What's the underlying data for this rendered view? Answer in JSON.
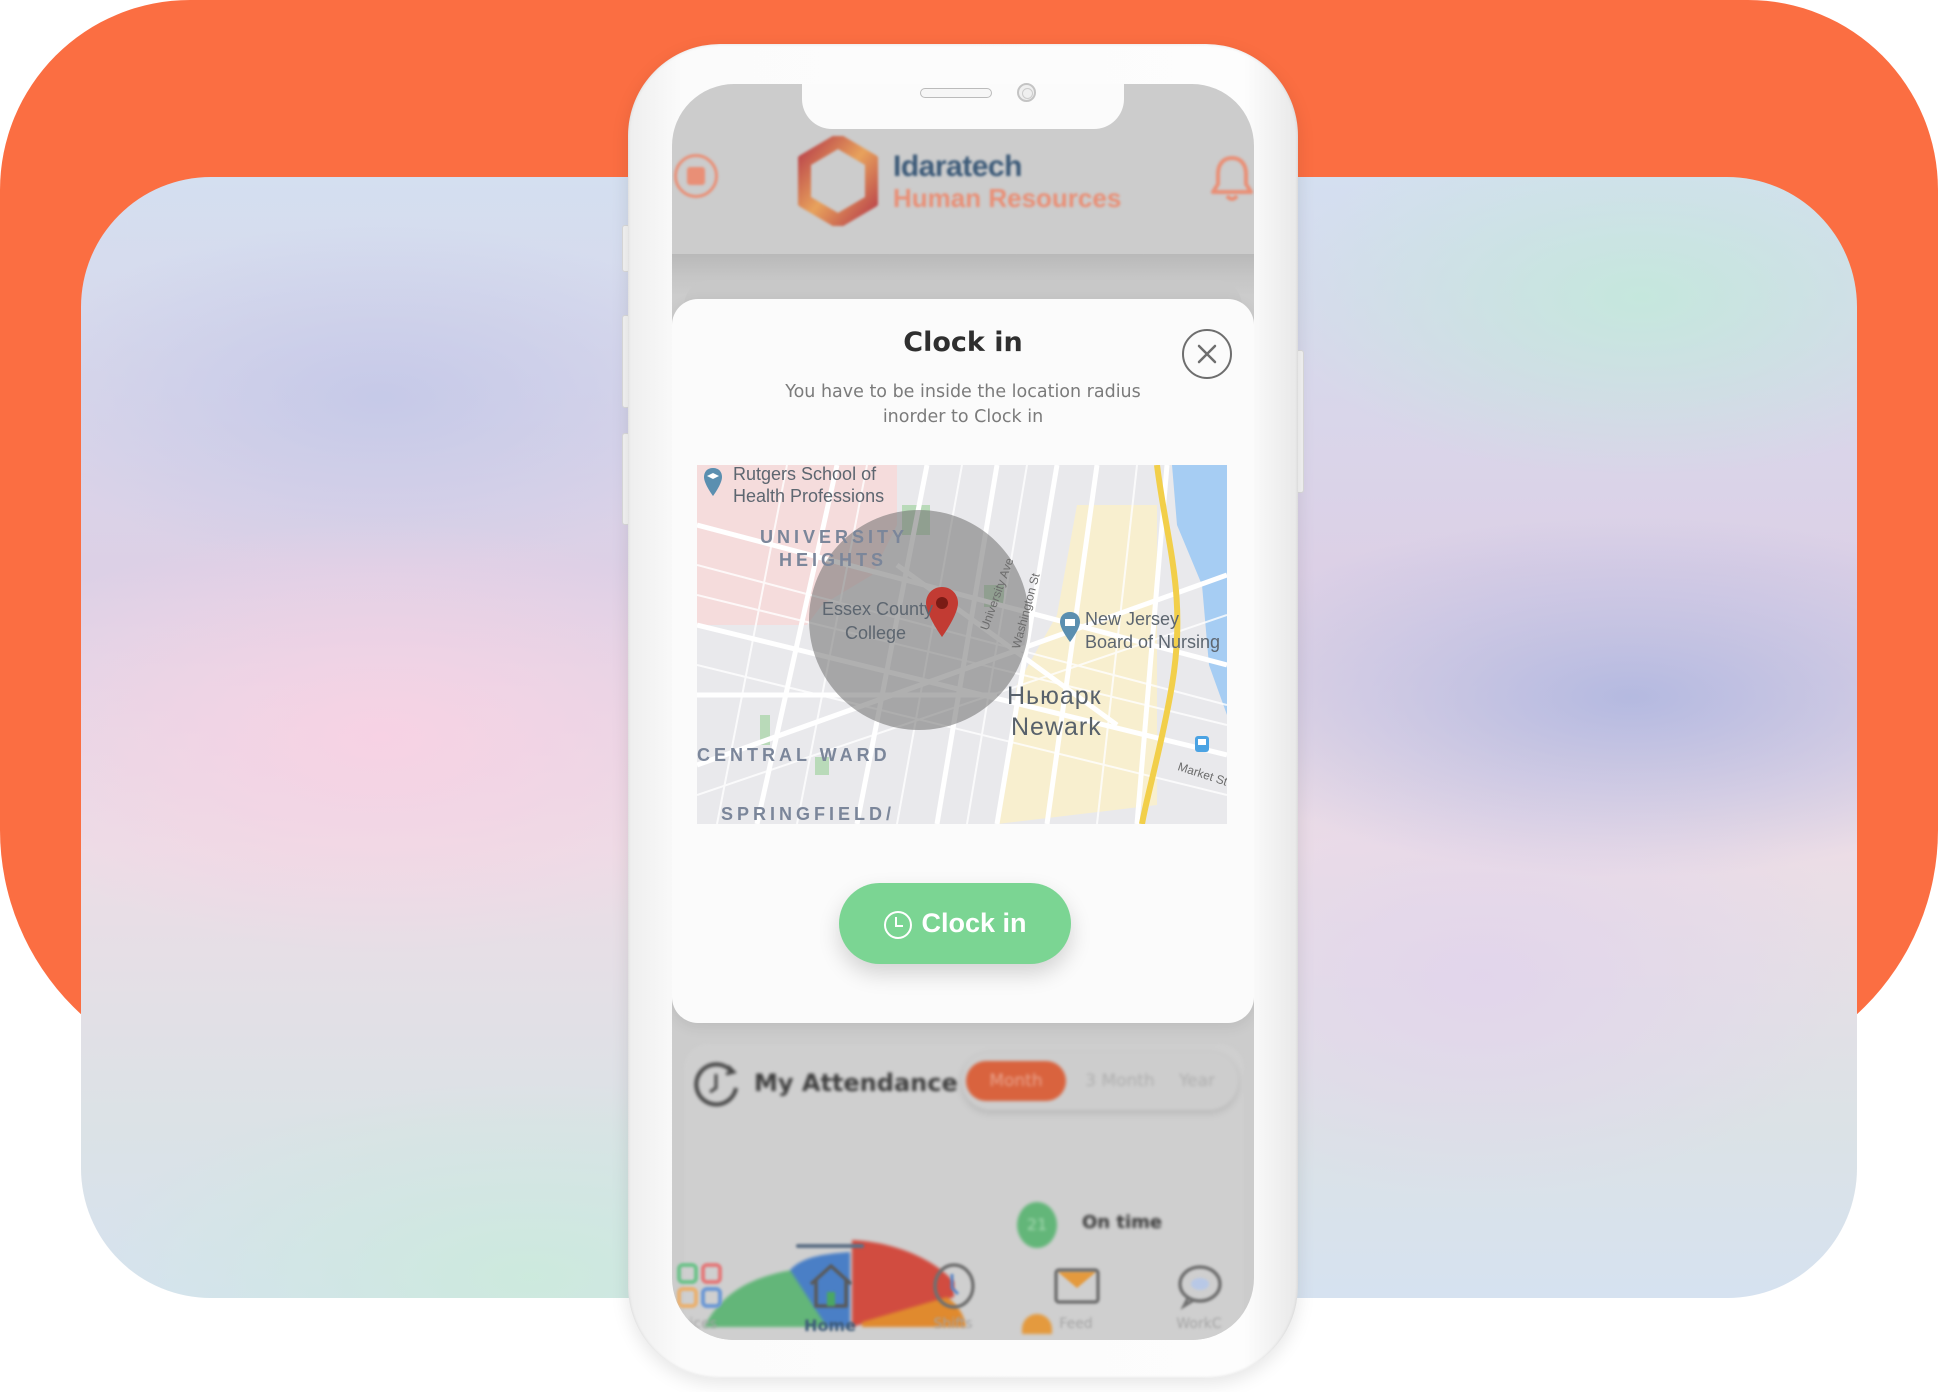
{
  "colors": {
    "background_orange": "#FB6E42",
    "clock_in_green": "#7BD593",
    "active_tab": "#D9633E",
    "brand_blue": "#3C5A78",
    "brand_orange": "#E98F76"
  },
  "app_header": {
    "brand_name": "Idaratech",
    "brand_subtitle": "Human Resources",
    "menu_icon": "menu-circle-icon",
    "notification_icon": "bell-icon"
  },
  "modal": {
    "title": "Clock in",
    "description": "You have to be inside the location radius inorder to Clock in",
    "close_icon": "close-icon",
    "map": {
      "labels": {
        "poi_rutgers": "Rutgers School of Health Professions",
        "area_university_heights_1": "UNIVERSITY",
        "area_university_heights_2": "HEIGHTS",
        "poi_essex_1": "Essex County",
        "poi_essex_2": "College",
        "street_university_ave": "University Ave",
        "street_washington": "Washington St",
        "poi_nj_board_1": "New Jersey",
        "poi_nj_board_2": "Board of Nursing",
        "city_ru": "Ньюарк",
        "city_en": "Newark",
        "area_central_ward": "CENTRAL WARD",
        "area_springfield": "SPRINGFIELD/",
        "street_market": "Market St"
      },
      "marker_icon": "location-pin-icon"
    },
    "clock_in_button": {
      "label": "Clock in",
      "icon": "clock-icon"
    }
  },
  "attendance": {
    "title": "My Attendance",
    "tabs": [
      {
        "label": "Month",
        "active": true
      },
      {
        "label": "3 Month",
        "active": false
      },
      {
        "label": "Year",
        "active": false
      }
    ],
    "legend": [
      {
        "count": "21",
        "label": "On time",
        "color": "#63B679"
      }
    ]
  },
  "bottom_nav": {
    "items": [
      {
        "label": "vices",
        "icon": "services-grid-icon",
        "active": false
      },
      {
        "label": "Home",
        "icon": "home-icon",
        "active": true
      },
      {
        "label": "Shifts",
        "icon": "clock-icon",
        "active": false
      },
      {
        "label": "Feed",
        "icon": "envelope-icon",
        "active": false
      },
      {
        "label": "WorkC",
        "icon": "chat-bubble-icon",
        "active": false
      }
    ]
  }
}
